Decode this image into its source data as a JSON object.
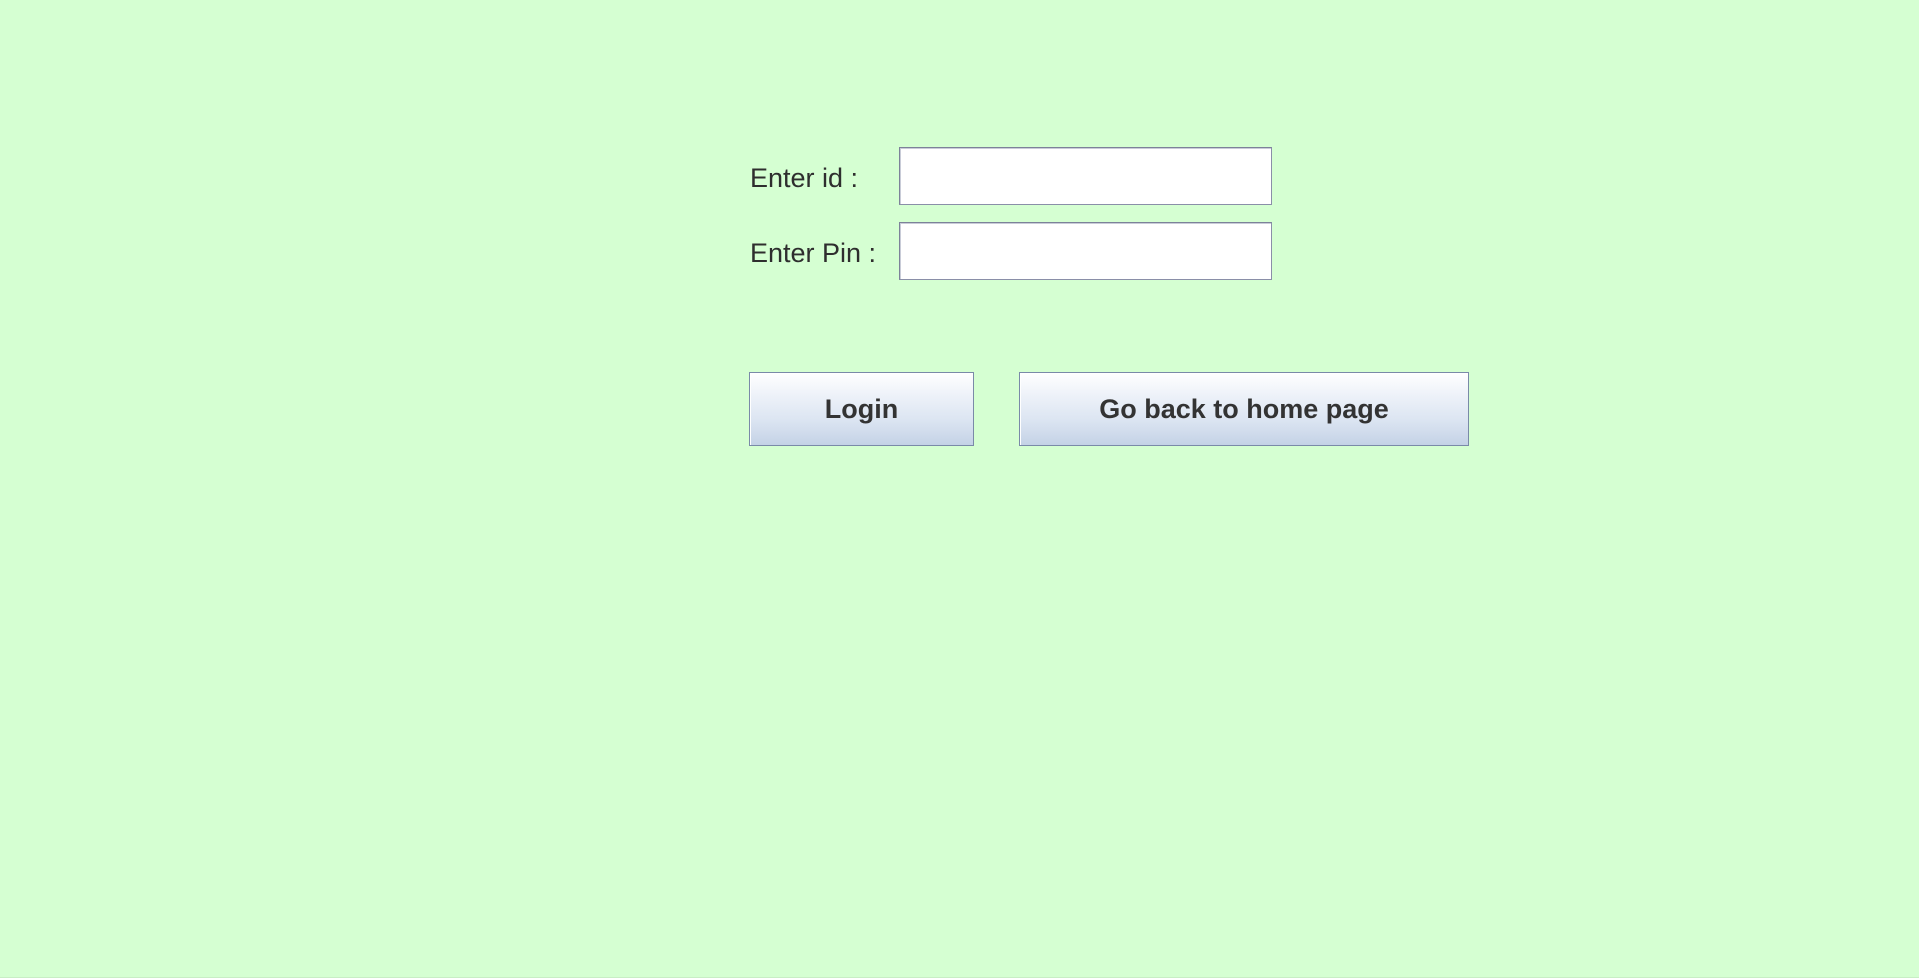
{
  "login_form": {
    "id_label": "Enter id :",
    "id_value": "",
    "pin_label": "Enter Pin :",
    "pin_value": "",
    "login_button": "Login",
    "home_button": "Go back to home page"
  },
  "colors": {
    "background": "#d5ffd2",
    "button_gradient_top": "#ffffff",
    "button_gradient_bottom": "#c4d2e6",
    "field_border": "#8a8fa8",
    "text": "#2e2e2e"
  }
}
